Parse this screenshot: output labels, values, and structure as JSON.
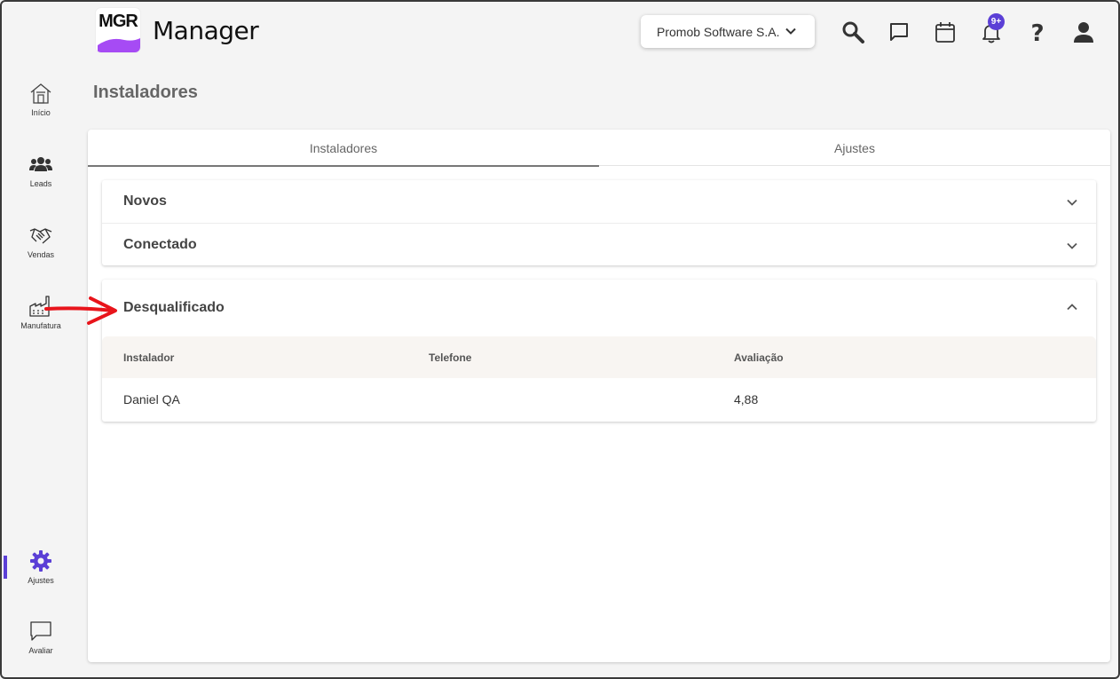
{
  "header": {
    "logo_text": "MGR",
    "app_title": "Manager",
    "company": "Promob Software S.A.",
    "notification_count": "9+"
  },
  "sidebar": {
    "items": [
      {
        "label": "Início",
        "icon": "home-icon"
      },
      {
        "label": "Leads",
        "icon": "people-icon"
      },
      {
        "label": "Vendas",
        "icon": "handshake-icon"
      },
      {
        "label": "Manufatura",
        "icon": "factory-icon"
      },
      {
        "label": "Ajustes",
        "icon": "gear-icon"
      },
      {
        "label": "Avaliar",
        "icon": "chat-icon"
      }
    ],
    "active": "Ajustes"
  },
  "page": {
    "title": "Instaladores"
  },
  "tabs": [
    {
      "label": "Instaladores",
      "active": true
    },
    {
      "label": "Ajustes",
      "active": false
    }
  ],
  "accordion": {
    "collapsed": [
      {
        "label": "Novos"
      },
      {
        "label": "Conectado"
      }
    ],
    "expanded": {
      "label": "Desqualificado",
      "columns": [
        "Instalador",
        "Telefone",
        "Avaliação"
      ],
      "rows": [
        {
          "instalador": "Daniel QA",
          "telefone": "",
          "avaliacao": "4,88"
        }
      ]
    }
  },
  "colors": {
    "accent": "#5b3fd6",
    "annotation_arrow": "#e8141b"
  }
}
